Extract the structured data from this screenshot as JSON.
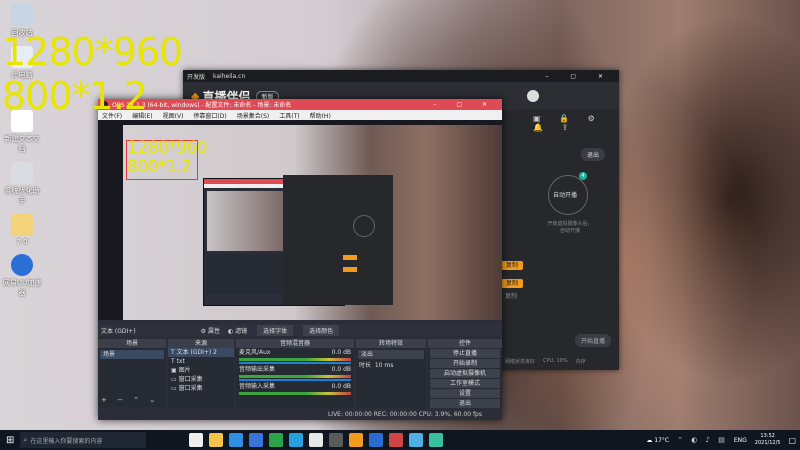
{
  "overlay": {
    "line1": "1280*960",
    "line2": "800*1.2"
  },
  "desktop_icons": [
    {
      "label": "回收站",
      "color": "#c7d4e3"
    },
    {
      "label": "此电脑",
      "color": "#e6edf5"
    },
    {
      "label": "新建文本文档",
      "color": "#ffffff"
    },
    {
      "label": "系统优化助手",
      "color": "#d9dde2"
    },
    {
      "label": "7.0",
      "color": "#f2d27a"
    },
    {
      "label": "网易UU加速器",
      "color": "#2b6fd6"
    }
  ],
  "companion": {
    "top_title": "开发版",
    "url": "kaiheila.cn",
    "logo": "直播伴侣",
    "version": "新版",
    "exit_label": "退出",
    "auto_label": "自动开播",
    "step_caption": "开启虚拟摄像头后，",
    "step_caption2": "自动开播",
    "btn1": "复制",
    "btn2": "复制",
    "btn3": "复制",
    "start_label": "开始直播",
    "stats": [
      "网络状态良好",
      "CPU: 10%",
      "内存"
    ]
  },
  "obs": {
    "title": "OBS 27.1.3 (64-bit, windows) - 配置文件: 未命名 - 场景: 未命名",
    "menu": [
      "文件(F)",
      "编辑(E)",
      "视图(V)",
      "停靠窗口(D)",
      "场景集合(S)",
      "工具(T)",
      "帮助(H)"
    ],
    "source_label": "文本 (GDI+)",
    "props_label": "属性",
    "filters_label": "滤镜",
    "choose_text": "选择字体",
    "choose_color": "选择颜色",
    "docks": {
      "scenes": "场景",
      "sources": "来源",
      "mixer": "音频混音器",
      "transitions": "转场特效",
      "controls": "控件"
    },
    "scene_item": "场景",
    "sources_list": [
      "文本 (GDI+) 2",
      "txt",
      "图片",
      "窗口采集",
      "窗口采集"
    ],
    "mixer_tracks": [
      {
        "name": "麦克风/Aux",
        "db": "0.0 dB"
      },
      {
        "name": "音频输出采集",
        "db": "0.0 dB"
      },
      {
        "name": "音频输入采集",
        "db": "0.0 dB"
      }
    ],
    "transition": "淡出",
    "duration_label": "时长",
    "duration_value": "10 ms",
    "controls": [
      "停止直播",
      "开始录制",
      "启动虚拟摄像机",
      "工作室模式",
      "设置",
      "退出"
    ],
    "status": "LIVE: 00:00:00   REC: 00:00:00   CPU: 3.9%, 60.00 fps"
  },
  "taskbar": {
    "search_placeholder": "在这里输入你要搜索的内容",
    "weather": "17°C",
    "lang": "ENG",
    "time": "13:52",
    "date": "2021/12/5"
  }
}
